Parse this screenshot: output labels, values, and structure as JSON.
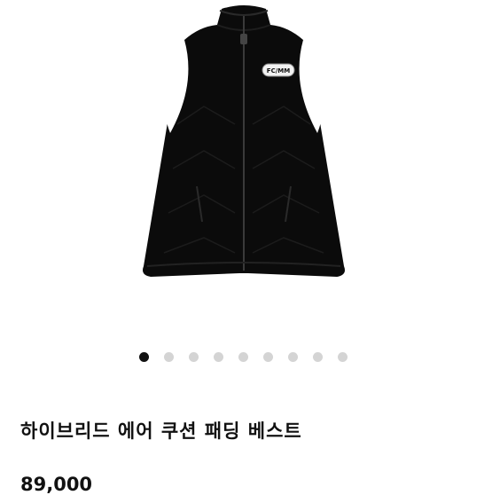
{
  "product": {
    "title": "하이브리드 에어 쿠션 패딩 베스트",
    "price": "89,000",
    "badge_text": "FC/MM",
    "image_icon": "padded-vest-image"
  },
  "carousel": {
    "total": 9,
    "active_index": 0,
    "active_color": "#111111",
    "inactive_color": "#d4d4d4"
  }
}
